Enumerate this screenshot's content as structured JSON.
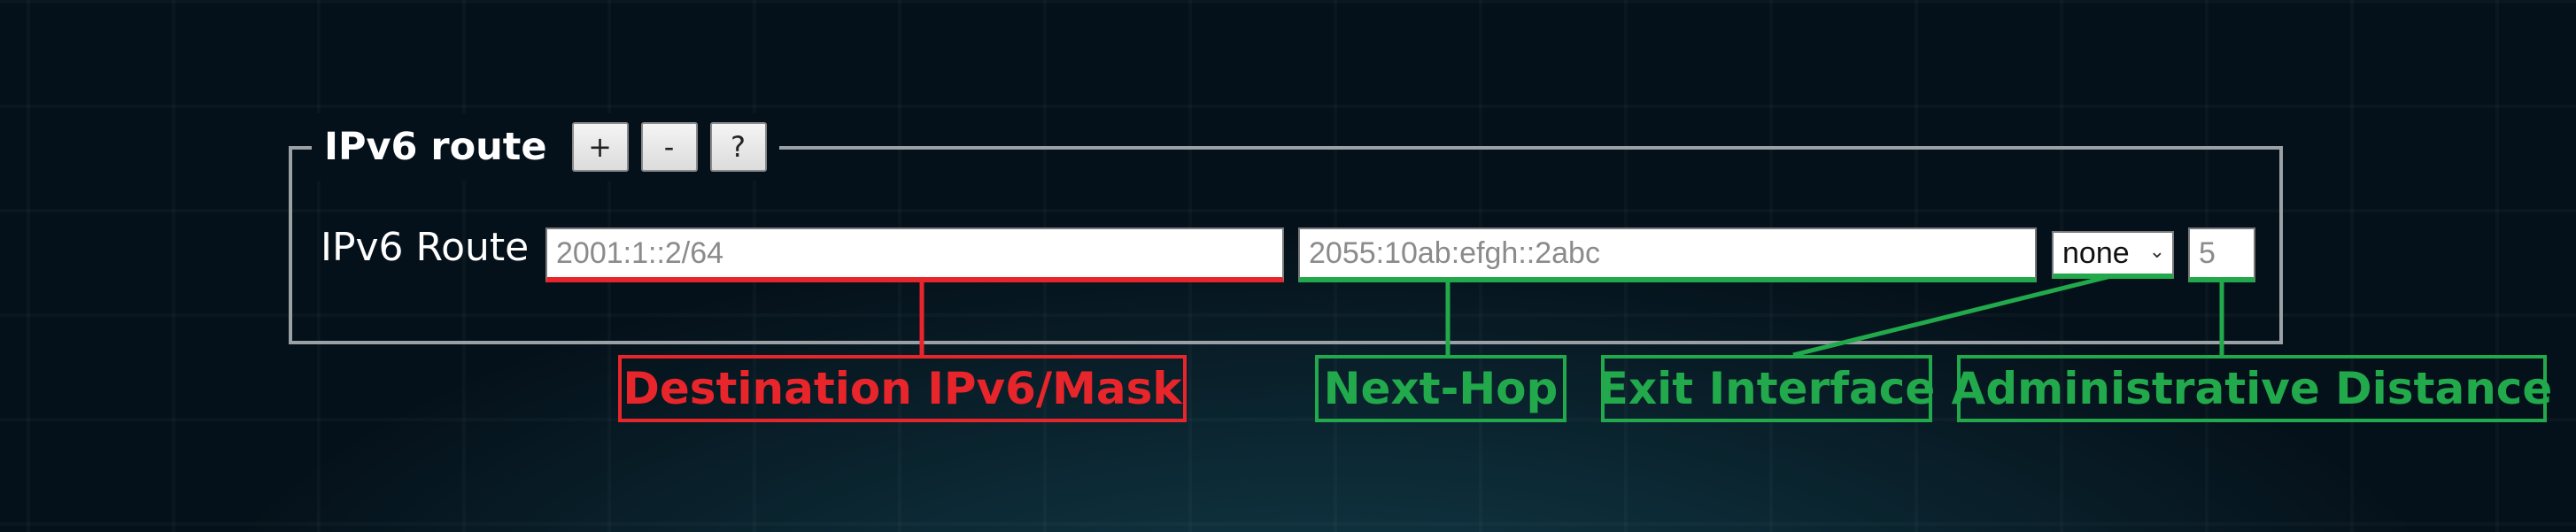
{
  "fieldset": {
    "title": "IPv6 route",
    "buttons": {
      "add": "+",
      "remove": "-",
      "help": "?"
    }
  },
  "row": {
    "label": "IPv6 Route",
    "destination_placeholder": "2001:1::2/64",
    "next_hop_placeholder": "2055:10ab:efgh::2abc",
    "exit_interface_selected": "none",
    "admin_distance_placeholder": "5"
  },
  "callouts": {
    "destination": "Destination IPv6/Mask",
    "next_hop": "Next-Hop",
    "exit_interface": "Exit Interface",
    "admin_distance": "Administrative Distance"
  },
  "colors": {
    "red": "#e8252b",
    "green": "#22a94b",
    "background": "#05111a"
  }
}
